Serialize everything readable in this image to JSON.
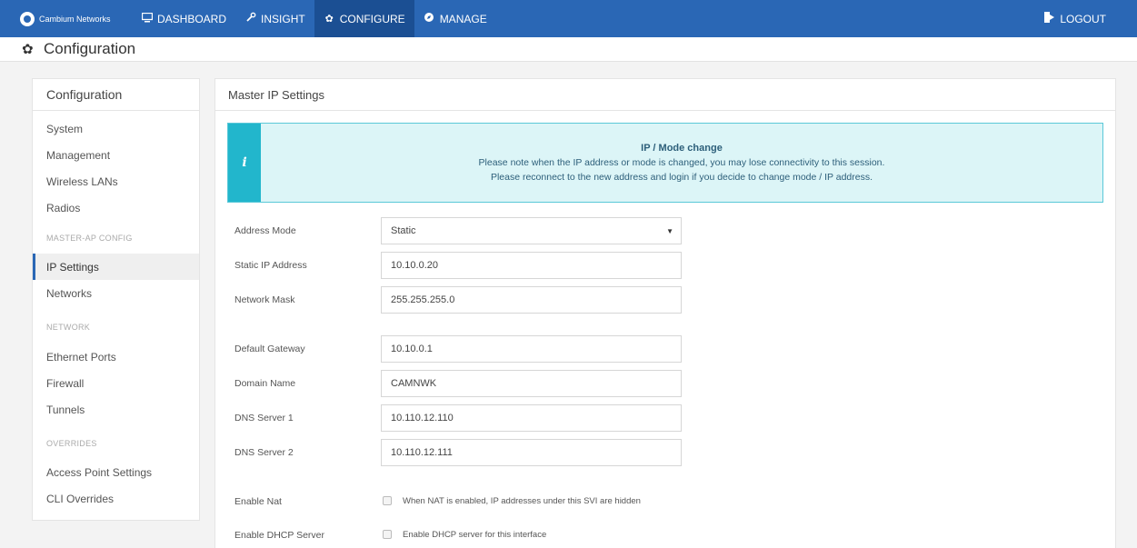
{
  "brand": {
    "name": "Cambium Networks"
  },
  "nav": {
    "items": [
      {
        "label": "DASHBOARD",
        "icon": "monitor-icon"
      },
      {
        "label": "INSIGHT",
        "icon": "wrench-icon"
      },
      {
        "label": "CONFIGURE",
        "icon": "gear-icon",
        "active": true
      },
      {
        "label": "MANAGE",
        "icon": "compass-icon"
      }
    ],
    "logout": "LOGOUT"
  },
  "page": {
    "title": "Configuration"
  },
  "sidebar": {
    "header": "Configuration",
    "items": [
      {
        "label": "System"
      },
      {
        "label": "Management"
      },
      {
        "label": "Wireless LANs"
      },
      {
        "label": "Radios"
      },
      {
        "label": "IP Settings",
        "active": true
      },
      {
        "label": "Networks"
      },
      {
        "label": "Ethernet Ports"
      },
      {
        "label": "Firewall"
      },
      {
        "label": "Tunnels"
      },
      {
        "label": "Access Point Settings"
      },
      {
        "label": "CLI Overrides"
      }
    ],
    "sections": [
      "MASTER-AP CONFIG",
      "NETWORK",
      "OVERRIDES"
    ]
  },
  "main": {
    "header": "Master IP Settings",
    "alert": {
      "title": "IP / Mode change",
      "line1": "Please note when the IP address or mode is changed, you may lose connectivity to this session.",
      "line2": "Please reconnect to the new address and login if you decide to change mode / IP address."
    },
    "fields": {
      "address_mode": {
        "label": "Address Mode",
        "value": "Static"
      },
      "static_ip": {
        "label": "Static IP Address",
        "value": "10.10.0.20"
      },
      "network_mask": {
        "label": "Network Mask",
        "value": "255.255.255.0"
      },
      "default_gateway": {
        "label": "Default Gateway",
        "value": "10.10.0.1"
      },
      "domain_name": {
        "label": "Domain Name",
        "value": "CAMNWK"
      },
      "dns1": {
        "label": "DNS Server 1",
        "value": "10.110.12.110"
      },
      "dns2": {
        "label": "DNS Server 2",
        "value": "10.110.12.111"
      }
    },
    "checkboxes": {
      "nat": {
        "label": "Enable Nat",
        "text": "When NAT is enabled, IP addresses under this SVI are hidden",
        "checked": false
      },
      "dhcp": {
        "label": "Enable DHCP Server",
        "text": "Enable DHCP server for this interface",
        "checked": false
      }
    }
  }
}
